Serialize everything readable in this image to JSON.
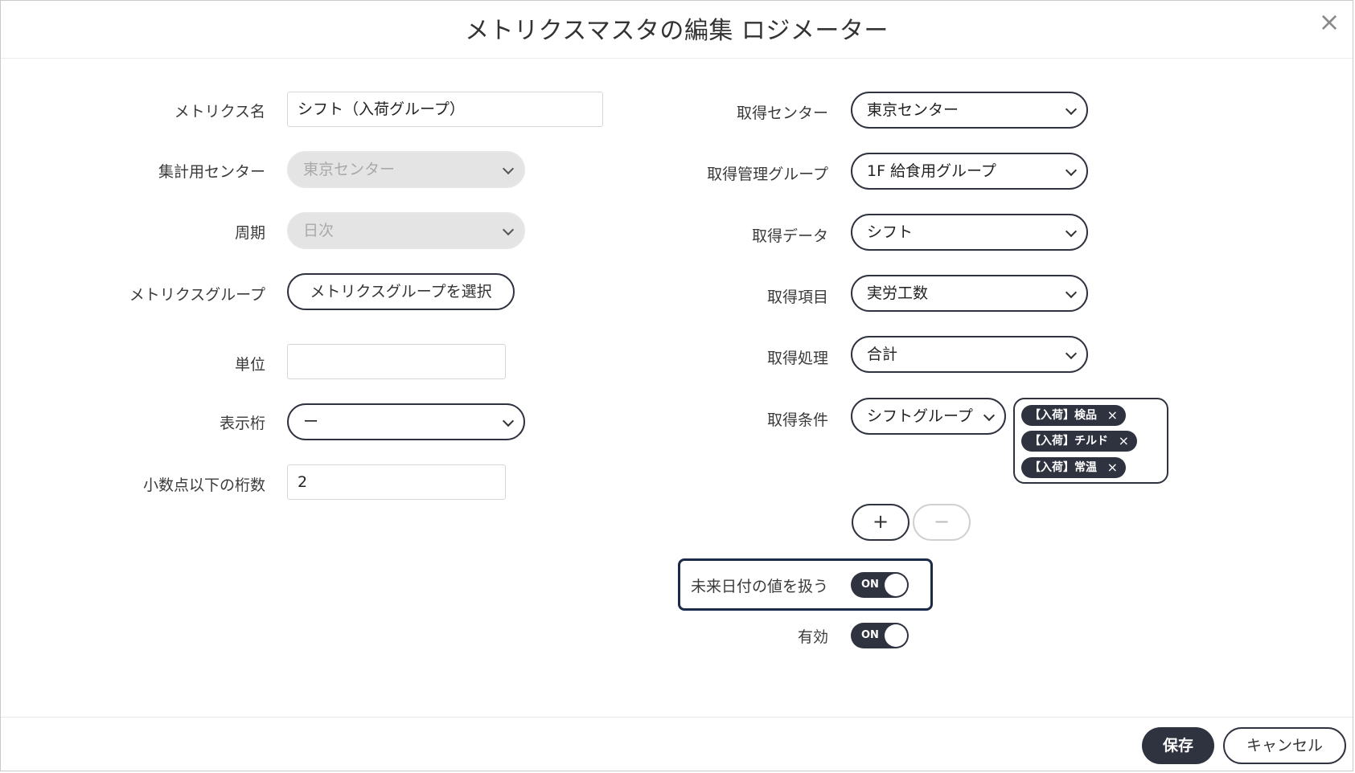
{
  "dialog": {
    "title": "メトリクスマスタの編集 ロジメーター",
    "close_symbol": "×"
  },
  "left": {
    "metric_name_label": "メトリクス名",
    "metric_name_value": "シフト（入荷グループ）",
    "agg_center_label": "集計用センター",
    "agg_center_value": "東京センター",
    "period_label": "周期",
    "period_value": "日次",
    "metric_group_label": "メトリクスグループ",
    "metric_group_button": "メトリクスグループを選択",
    "unit_label": "単位",
    "unit_value": "",
    "display_digits_label": "表示桁",
    "display_digits_value": "ー",
    "decimal_digits_label": "小数点以下の桁数",
    "decimal_digits_value": "2"
  },
  "right": {
    "acq_center_label": "取得センター",
    "acq_center_value": "東京センター",
    "acq_group_label": "取得管理グループ",
    "acq_group_value": "1F 給食用グループ",
    "acq_data_label": "取得データ",
    "acq_data_value": "シフト",
    "acq_item_label": "取得項目",
    "acq_item_value": "実労工数",
    "acq_process_label": "取得処理",
    "acq_process_value": "合計",
    "acq_condition_label": "取得条件",
    "acq_condition_value": "シフトグループ",
    "condition_tags": [
      "【入荷】検品",
      "【入荷】チルド",
      "【入荷】常温"
    ],
    "add_symbol": "+",
    "remove_symbol": "−",
    "future_values_label": "未来日付の値を扱う",
    "future_values_toggle": "ON",
    "enabled_label": "有効",
    "enabled_toggle": "ON"
  },
  "footer": {
    "save_label": "保存",
    "cancel_label": "キャンセル"
  }
}
